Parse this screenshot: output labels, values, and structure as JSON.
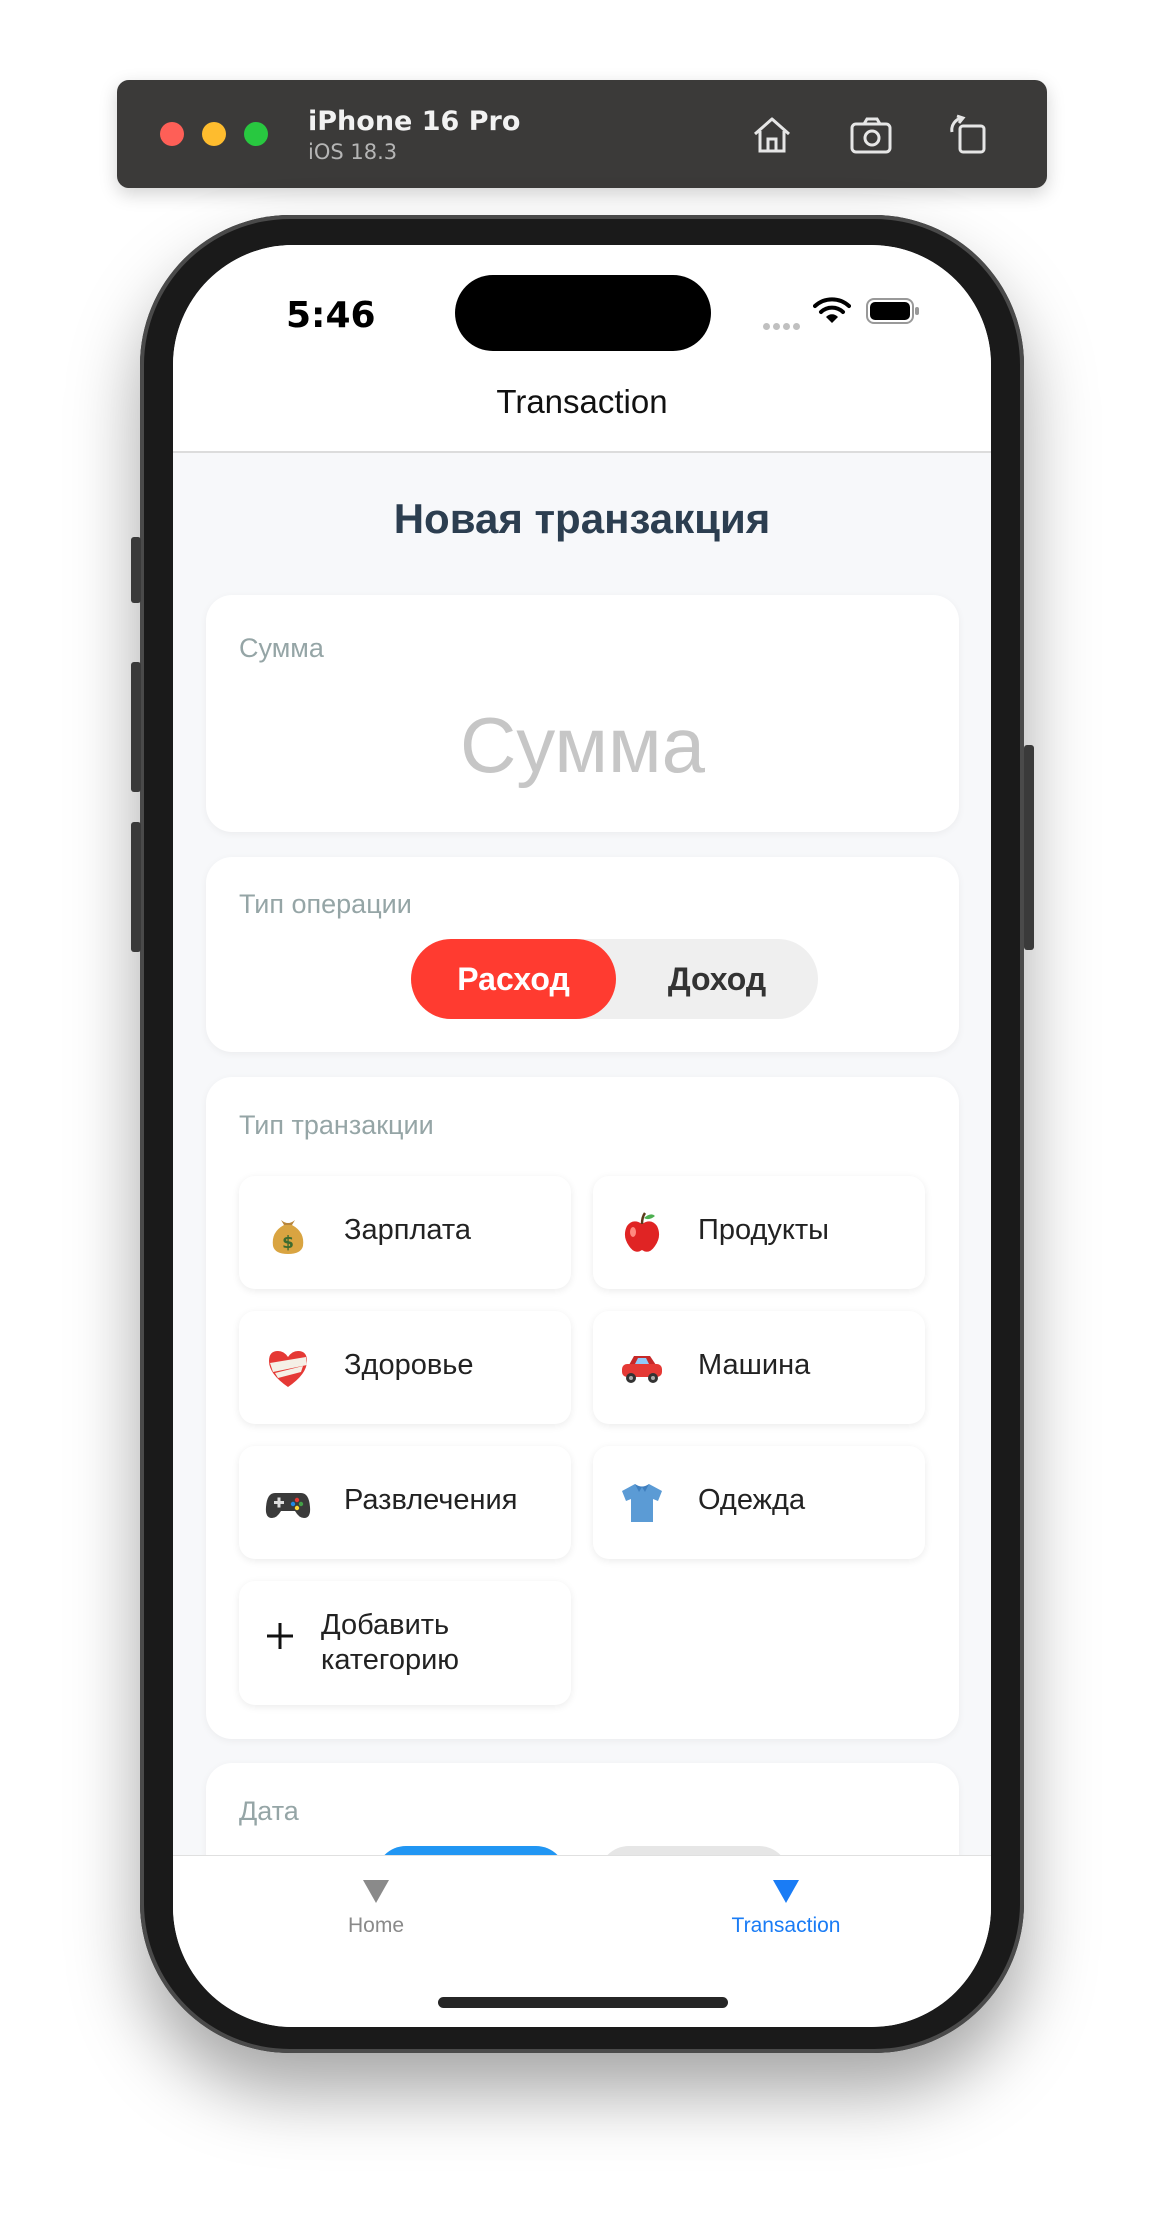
{
  "simulator": {
    "device_name": "iPhone 16 Pro",
    "os_version": "iOS 18.3",
    "buttons": [
      "home-icon",
      "screenshot-icon",
      "rotate-icon"
    ]
  },
  "status_bar": {
    "time": "5:46"
  },
  "nav": {
    "title": "Transaction"
  },
  "page": {
    "title": "Новая транзакция"
  },
  "amount": {
    "label": "Сумма",
    "placeholder": "Сумма",
    "value": ""
  },
  "operation_type": {
    "label": "Тип операции",
    "options": [
      "Расход",
      "Доход"
    ],
    "selected": "Расход",
    "colors": {
      "expense_active": "#ff3b30",
      "inactive_bg": "#efefef"
    }
  },
  "transaction_type": {
    "label": "Тип транзакции",
    "categories": [
      {
        "icon": "money-bag-icon",
        "label": "Зарплата"
      },
      {
        "icon": "apple-icon",
        "label": "Продукты"
      },
      {
        "icon": "bandaged-heart-icon",
        "label": "Здоровье"
      },
      {
        "icon": "car-icon",
        "label": "Машина"
      },
      {
        "icon": "game-controller-icon",
        "label": "Развлечения"
      },
      {
        "icon": "shirt-icon",
        "label": "Одежда"
      }
    ],
    "add_category_label": "Добавить категорию"
  },
  "date": {
    "label": "Дата"
  },
  "tabbar": {
    "items": [
      {
        "label": "Home",
        "active": false
      },
      {
        "label": "Transaction",
        "active": true
      }
    ],
    "colors": {
      "active": "#1a7cf5",
      "inactive": "#8a8a8a"
    }
  }
}
